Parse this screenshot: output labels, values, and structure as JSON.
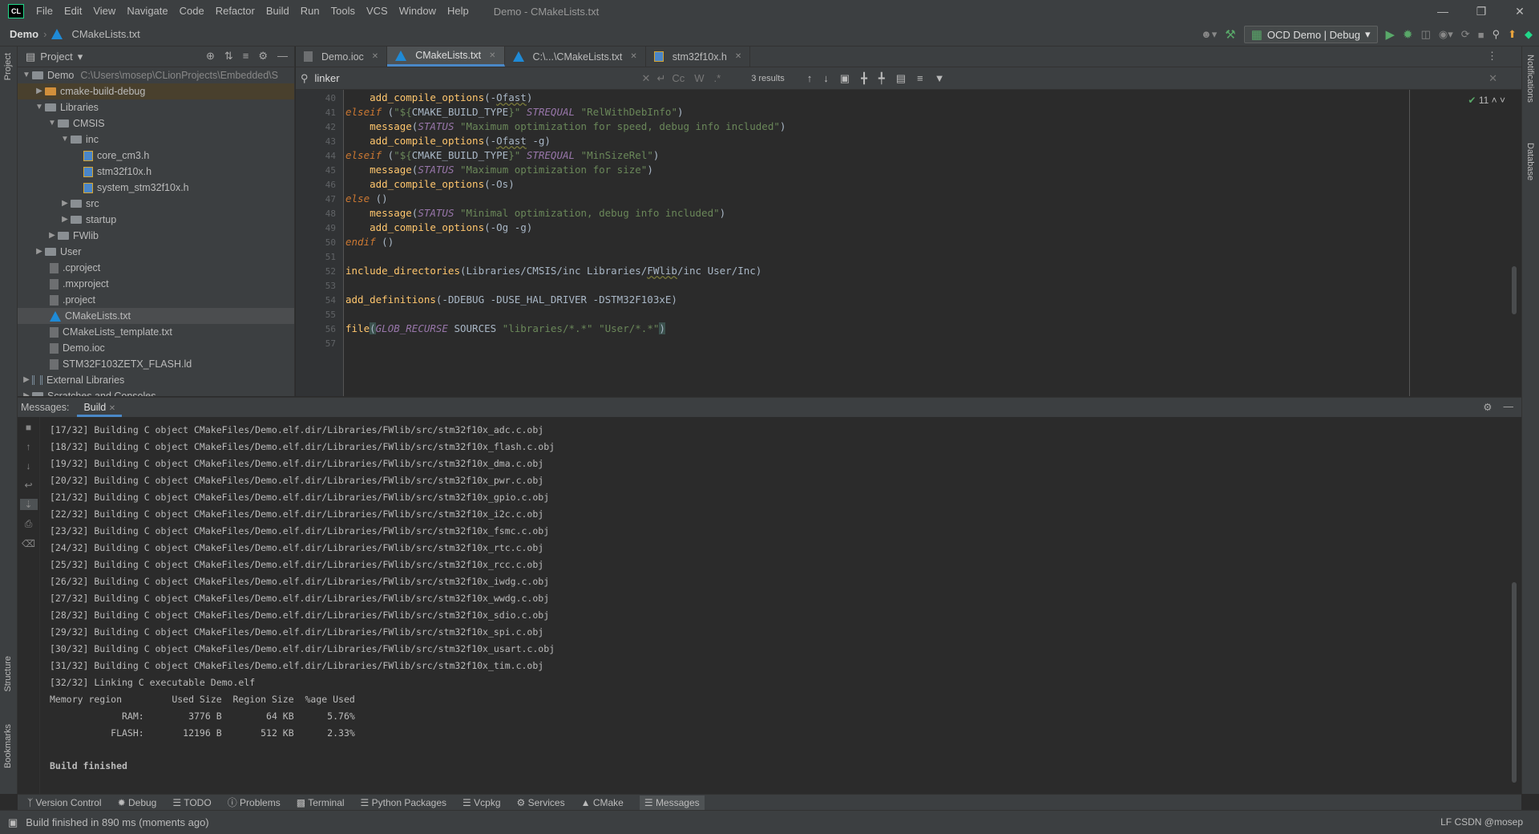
{
  "app": {
    "logo": "CL",
    "menu": [
      "File",
      "Edit",
      "View",
      "Navigate",
      "Code",
      "Refactor",
      "Build",
      "Run",
      "Tools",
      "VCS",
      "Window",
      "Help"
    ],
    "window_title": "Demo - CMakeLists.txt"
  },
  "navbar": {
    "project": "Demo",
    "file": "CMakeLists.txt",
    "run_config": "OCD Demo | Debug"
  },
  "project_panel": {
    "title": "Project",
    "tree": [
      {
        "label": "Demo",
        "path": "C:\\Users\\mosep\\CLionProjects\\Embedded\\S",
        "kind": "root"
      },
      {
        "label": "cmake-build-debug",
        "kind": "build"
      },
      {
        "label": "Libraries"
      },
      {
        "label": "CMSIS"
      },
      {
        "label": "inc"
      },
      {
        "label": "core_cm3.h"
      },
      {
        "label": "stm32f10x.h"
      },
      {
        "label": "system_stm32f10x.h"
      },
      {
        "label": "src"
      },
      {
        "label": "startup"
      },
      {
        "label": "FWlib"
      },
      {
        "label": "User"
      },
      {
        "label": ".cproject"
      },
      {
        "label": ".mxproject"
      },
      {
        "label": ".project"
      },
      {
        "label": "CMakeLists.txt"
      },
      {
        "label": "CMakeLists_template.txt"
      },
      {
        "label": "Demo.ioc"
      },
      {
        "label": "STM32F103ZETX_FLASH.ld"
      },
      {
        "label": "External Libraries"
      },
      {
        "label": "Scratches and Consoles"
      }
    ]
  },
  "tabs": [
    {
      "label": "Demo.ioc"
    },
    {
      "label": "CMakeLists.txt"
    },
    {
      "label": "C:\\...\\CMakeLists.txt"
    },
    {
      "label": "stm32f10x.h"
    }
  ],
  "find": {
    "query": "linker",
    "options": [
      "Cc",
      "W",
      ".*"
    ],
    "results": "3 results"
  },
  "editor": {
    "inspections": "11",
    "line_numbers": [
      "40",
      "41",
      "42",
      "43",
      "44",
      "45",
      "46",
      "47",
      "48",
      "49",
      "50",
      "51",
      "52",
      "53",
      "54",
      "55",
      "56",
      "57"
    ]
  },
  "messages": {
    "label": "Messages:",
    "tab": "Build",
    "lines": [
      "[17/32] Building C object CMakeFiles/Demo.elf.dir/Libraries/FWlib/src/stm32f10x_adc.c.obj",
      "[18/32] Building C object CMakeFiles/Demo.elf.dir/Libraries/FWlib/src/stm32f10x_flash.c.obj",
      "[19/32] Building C object CMakeFiles/Demo.elf.dir/Libraries/FWlib/src/stm32f10x_dma.c.obj",
      "[20/32] Building C object CMakeFiles/Demo.elf.dir/Libraries/FWlib/src/stm32f10x_pwr.c.obj",
      "[21/32] Building C object CMakeFiles/Demo.elf.dir/Libraries/FWlib/src/stm32f10x_gpio.c.obj",
      "[22/32] Building C object CMakeFiles/Demo.elf.dir/Libraries/FWlib/src/stm32f10x_i2c.c.obj",
      "[23/32] Building C object CMakeFiles/Demo.elf.dir/Libraries/FWlib/src/stm32f10x_fsmc.c.obj",
      "[24/32] Building C object CMakeFiles/Demo.elf.dir/Libraries/FWlib/src/stm32f10x_rtc.c.obj",
      "[25/32] Building C object CMakeFiles/Demo.elf.dir/Libraries/FWlib/src/stm32f10x_rcc.c.obj",
      "[26/32] Building C object CMakeFiles/Demo.elf.dir/Libraries/FWlib/src/stm32f10x_iwdg.c.obj",
      "[27/32] Building C object CMakeFiles/Demo.elf.dir/Libraries/FWlib/src/stm32f10x_wwdg.c.obj",
      "[28/32] Building C object CMakeFiles/Demo.elf.dir/Libraries/FWlib/src/stm32f10x_sdio.c.obj",
      "[29/32] Building C object CMakeFiles/Demo.elf.dir/Libraries/FWlib/src/stm32f10x_spi.c.obj",
      "[30/32] Building C object CMakeFiles/Demo.elf.dir/Libraries/FWlib/src/stm32f10x_usart.c.obj",
      "[31/32] Building C object CMakeFiles/Demo.elf.dir/Libraries/FWlib/src/stm32f10x_tim.c.obj",
      "[32/32] Linking C executable Demo.elf",
      "Memory region         Used Size  Region Size  %age Used",
      "             RAM:        3776 B        64 KB      5.76%",
      "           FLASH:       12196 B       512 KB      2.33%"
    ],
    "finished": "Build finished"
  },
  "tool_windows": [
    "Version Control",
    "Debug",
    "TODO",
    "Problems",
    "Terminal",
    "Python Packages",
    "Vcpkg",
    "Services",
    "CMake",
    "Messages"
  ],
  "strips": {
    "project": "Project",
    "structure": "Structure",
    "bookmarks": "Bookmarks",
    "notifications": "Notifications",
    "database": "Database"
  },
  "status": {
    "text": "Build finished in 890 ms (moments ago)",
    "right": "LF  CSDN @mosep"
  }
}
